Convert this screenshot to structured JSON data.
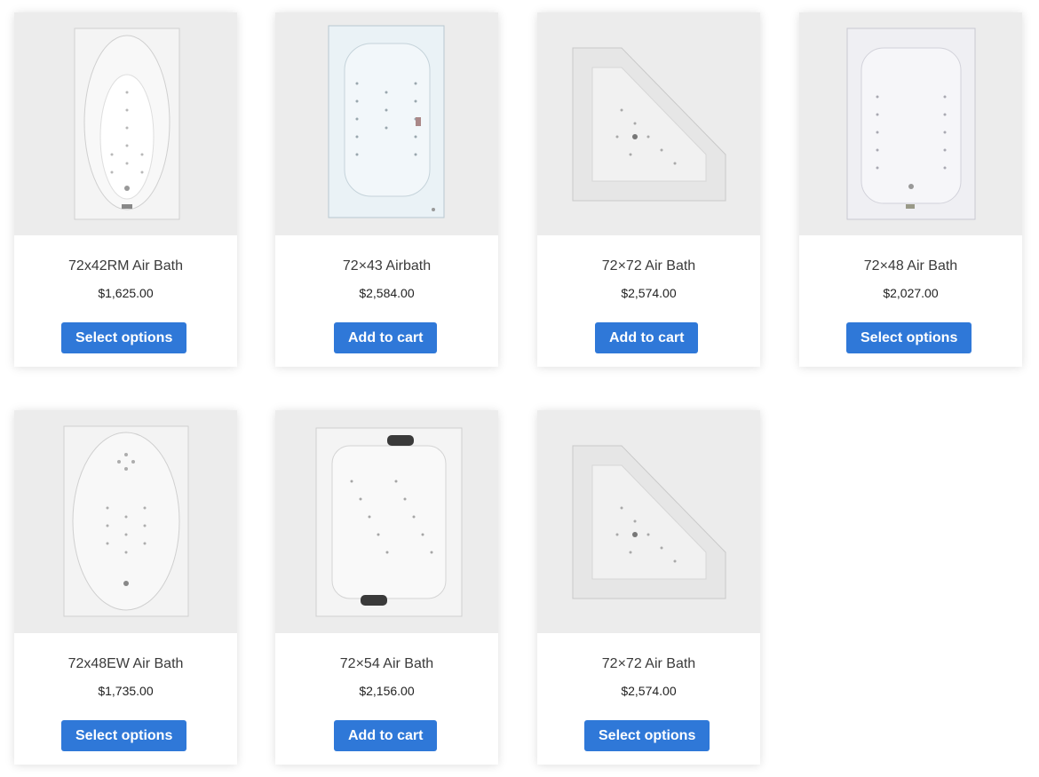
{
  "products": [
    {
      "name": "72x42RM Air Bath",
      "price": "$1,625.00",
      "button": "Select options",
      "image_icon": "oval-tub-icon"
    },
    {
      "name": "72×43 Airbath",
      "price": "$2,584.00",
      "button": "Add to cart",
      "image_icon": "rect-tub-icon"
    },
    {
      "name": "72×72 Air Bath",
      "price": "$2,574.00",
      "button": "Add to cart",
      "image_icon": "corner-tub-icon"
    },
    {
      "name": "72×48 Air Bath",
      "price": "$2,027.00",
      "button": "Select options",
      "image_icon": "rect-tub-icon"
    },
    {
      "name": "72x48EW Air Bath",
      "price": "$1,735.00",
      "button": "Select options",
      "image_icon": "oval-tub-icon"
    },
    {
      "name": "72×54 Air Bath",
      "price": "$2,156.00",
      "button": "Add to cart",
      "image_icon": "double-tub-icon"
    },
    {
      "name": "72×72 Air Bath",
      "price": "$2,574.00",
      "button": "Select options",
      "image_icon": "corner-tub-icon"
    }
  ],
  "colors": {
    "button_bg": "#2f78d8",
    "button_text": "#ffffff",
    "card_bg": "#ffffff",
    "image_bg": "#ececec"
  }
}
